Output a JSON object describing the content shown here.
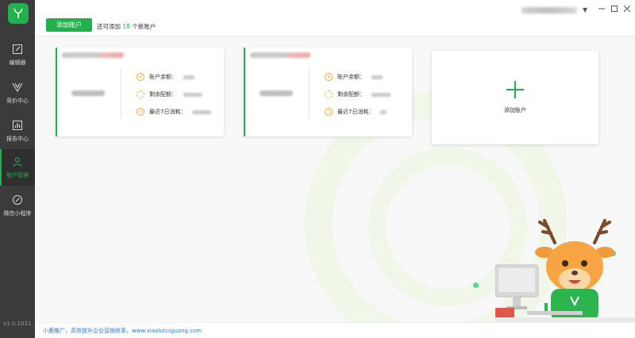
{
  "sidebar": {
    "logo_icon": "deer-logo-icon",
    "items": [
      {
        "label": "编辑器",
        "icon": "edit-icon",
        "active": false
      },
      {
        "label": "竞价中心",
        "icon": "bidding-icon",
        "active": false
      },
      {
        "label": "报告中心",
        "icon": "report-chart-icon",
        "active": false
      },
      {
        "label": "账户管理",
        "icon": "user-icon",
        "active": true
      },
      {
        "label": "微信小程序",
        "icon": "link-icon",
        "active": false
      }
    ],
    "version": "v1.0.1031"
  },
  "topbar": {
    "add_account_label": "添加账户",
    "remain_prefix": "还可添加",
    "remain_count": "18",
    "remain_suffix": "个新账户"
  },
  "cards": [
    {
      "balance_label": "账户余额：",
      "budget_label": "剩余配额：",
      "spend_label": "最近7日消耗："
    },
    {
      "balance_label": "账户余额：",
      "budget_label": "剩余配额：",
      "spend_label": "最近7日消耗："
    }
  ],
  "add_card": {
    "label": "添加账户"
  },
  "footer": {
    "text": "小鹿推广，高效提升企业营销效率，www.xiaolutuiguang.com"
  },
  "colors": {
    "accent": "#23b14d",
    "sidebar_bg": "#3b3b3b",
    "link": "#2a7bd5"
  }
}
